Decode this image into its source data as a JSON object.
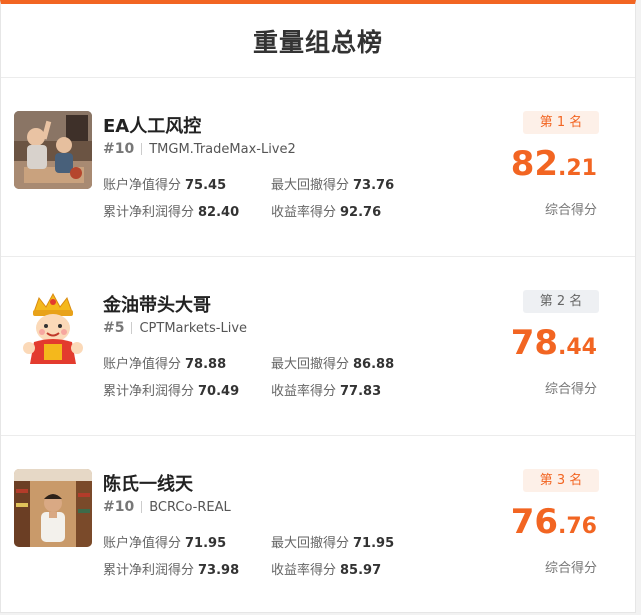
{
  "title": "重量组总榜",
  "colors": {
    "accent": "#f26522"
  },
  "entries": [
    {
      "name": "EA人工风控",
      "rank": "#10",
      "broker": "TMGM.TradeMax-Live2",
      "stats": {
        "equity_label": "账户净值得分",
        "equity": "75.45",
        "drawdown_label": "最大回撤得分",
        "drawdown": "73.76",
        "profit_label": "累计净利润得分",
        "profit": "82.40",
        "return_label": "收益率得分",
        "return": "92.76"
      },
      "badge": "第 1 名",
      "score_int": "82",
      "score_dec": "21",
      "score_label": "综合得分"
    },
    {
      "name": "金油带头大哥",
      "rank": "#5",
      "broker": "CPTMarkets-Live",
      "stats": {
        "equity_label": "账户净值得分",
        "equity": "78.88",
        "drawdown_label": "最大回撤得分",
        "drawdown": "86.88",
        "profit_label": "累计净利润得分",
        "profit": "70.49",
        "return_label": "收益率得分",
        "return": "77.83"
      },
      "badge": "第 2 名",
      "score_int": "78",
      "score_dec": "44",
      "score_label": "综合得分"
    },
    {
      "name": "陈氏一线天",
      "rank": "#10",
      "broker": "BCRCo-REAL",
      "stats": {
        "equity_label": "账户净值得分",
        "equity": "71.95",
        "drawdown_label": "最大回撤得分",
        "drawdown": "71.95",
        "profit_label": "累计净利润得分",
        "profit": "73.98",
        "return_label": "收益率得分",
        "return": "85.97"
      },
      "badge": "第 3 名",
      "score_int": "76",
      "score_dec": "76",
      "score_label": "综合得分"
    }
  ]
}
